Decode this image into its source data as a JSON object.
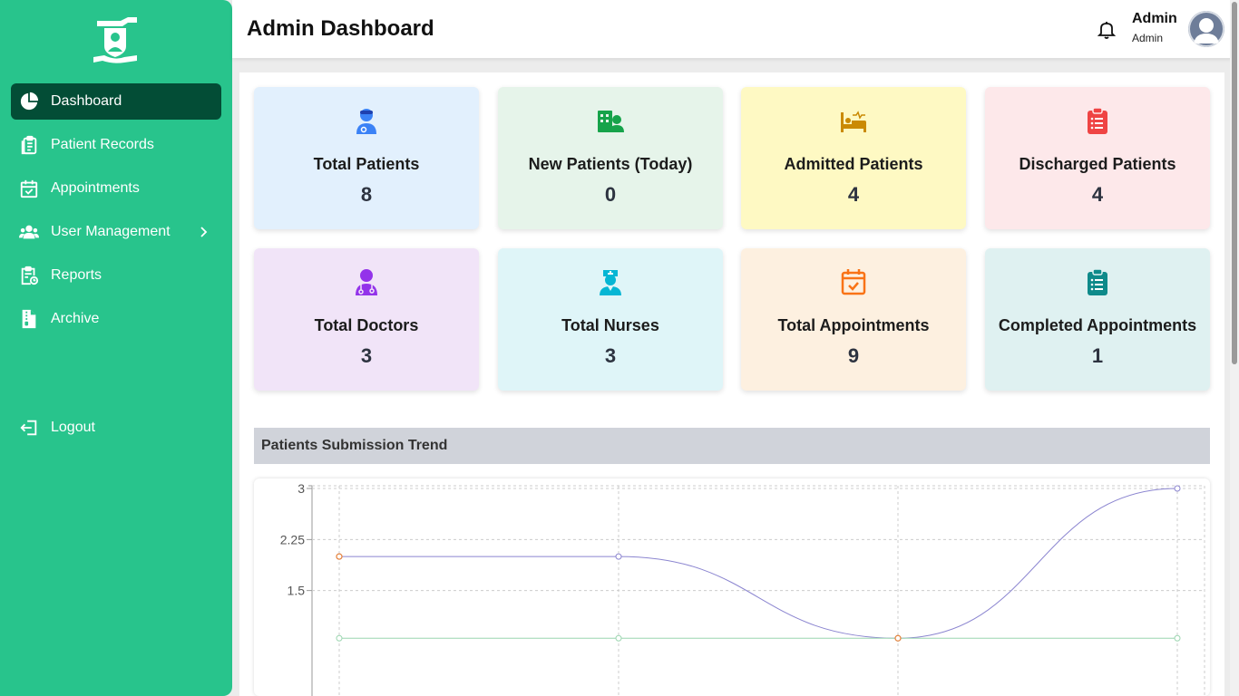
{
  "sidebar": {
    "items": [
      {
        "label": "Dashboard",
        "icon": "pie-chart-icon",
        "active": true
      },
      {
        "label": "Patient Records",
        "icon": "clipboard-list-icon"
      },
      {
        "label": "Appointments",
        "icon": "calendar-check-icon"
      },
      {
        "label": "User Management",
        "icon": "users-icon",
        "has_submenu": true
      },
      {
        "label": "Reports",
        "icon": "report-clock-icon"
      },
      {
        "label": "Archive",
        "icon": "archive-file-icon"
      }
    ],
    "logout_label": "Logout"
  },
  "header": {
    "title": "Admin Dashboard",
    "user_name": "Admin",
    "user_role": "Admin"
  },
  "stats": [
    {
      "label": "Total Patients",
      "value": "8",
      "icon": "patient-icon",
      "bg": "#e2f0fd",
      "icon_color": "#3b82f6"
    },
    {
      "label": "New Patients (Today)",
      "value": "0",
      "icon": "hospital-user-icon",
      "bg": "#e6f4ea",
      "icon_color": "#16a34a"
    },
    {
      "label": "Admitted Patients",
      "value": "4",
      "icon": "hospital-bed-icon",
      "bg": "#fef9c3",
      "icon_color": "#ca8a04"
    },
    {
      "label": "Discharged Patients",
      "value": "4",
      "icon": "clipboard-list-icon",
      "bg": "#fde8ea",
      "icon_color": "#ef4444"
    },
    {
      "label": "Total Doctors",
      "value": "3",
      "icon": "doctor-icon",
      "bg": "#f1e4f8",
      "icon_color": "#9333ea"
    },
    {
      "label": "Total Nurses",
      "value": "3",
      "icon": "nurse-icon",
      "bg": "#dff5f8",
      "icon_color": "#06b6d4"
    },
    {
      "label": "Total Appointments",
      "value": "9",
      "icon": "calendar-check-icon",
      "bg": "#fdf0e0",
      "icon_color": "#f97316"
    },
    {
      "label": "Completed Appointments",
      "value": "1",
      "icon": "clipboard-list-icon",
      "bg": "#dff1f1",
      "icon_color": "#0e8a8a"
    }
  ],
  "chart_section": {
    "title": "Patients Submission Trend"
  },
  "chart_data": {
    "type": "line",
    "title": "Patients Submission Trend",
    "x": [
      0,
      1,
      2,
      3
    ],
    "ylim": [
      0.75,
      3
    ],
    "yticks": [
      "3",
      "2.25",
      "1.5"
    ],
    "grid": true,
    "series": [
      {
        "values": [
          2,
          2,
          0.8,
          3
        ],
        "color": "#8b85d0",
        "point_color": "#8b85d0"
      },
      {
        "values": [
          0.8,
          0.8,
          0.8,
          0.8
        ],
        "color": "#9bd6b0",
        "point_color": "#9bd6b0"
      }
    ],
    "highlight_points": [
      {
        "x": 0,
        "y": 2,
        "color": "#e8833a"
      },
      {
        "x": 2,
        "y": 0.8,
        "color": "#e8833a"
      }
    ]
  }
}
